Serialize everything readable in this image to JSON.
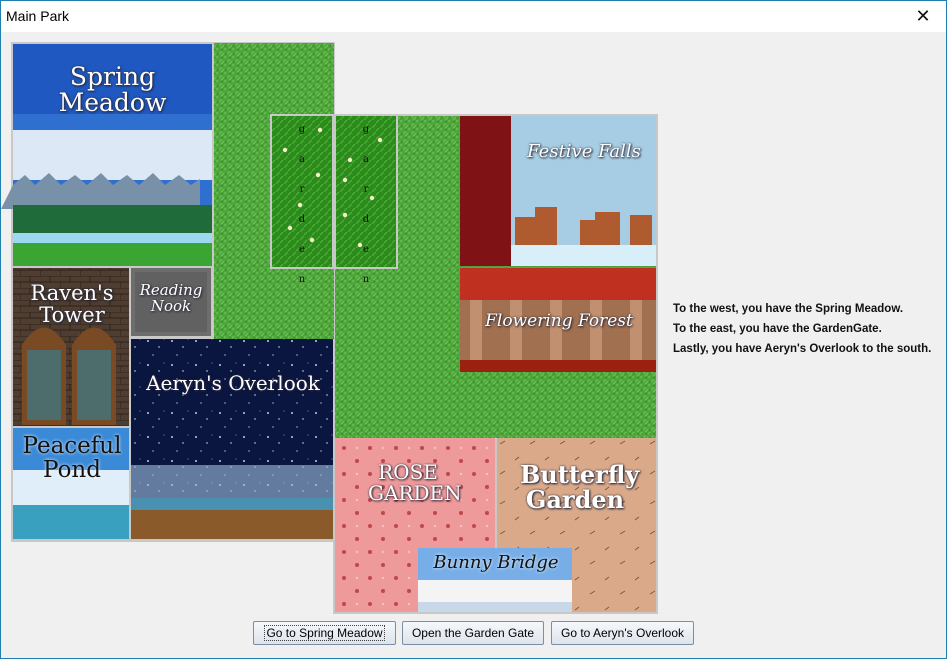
{
  "window": {
    "title": "Main Park",
    "close_label": "✕"
  },
  "areas": {
    "spring_meadow": "Spring Meadow",
    "ravens_tower": "Raven's Tower",
    "reading_nook": "Reading Nook",
    "aeryns_overlook": "Aeryn's Overlook",
    "peaceful_pond": "Peaceful Pond",
    "festive_falls": "Festive Falls",
    "flowering_forest": "Flowering Forest",
    "rose_garden": "ROSE GARDEN",
    "butterfly_garden": "Butterfly Garden",
    "bunny_bridge": "Bunny Bridge",
    "gate_letters": "Garden"
  },
  "description": {
    "line1": "To the west, you have the Spring Meadow.",
    "line2": "To the east, you have the GardenGate.",
    "line3": "Lastly, you have Aeryn's Overlook to the south."
  },
  "buttons": {
    "spring_meadow": "Go to Spring Meadow",
    "garden_gate": "Open the Garden Gate",
    "overlook": "Go to Aeryn's Overlook"
  }
}
